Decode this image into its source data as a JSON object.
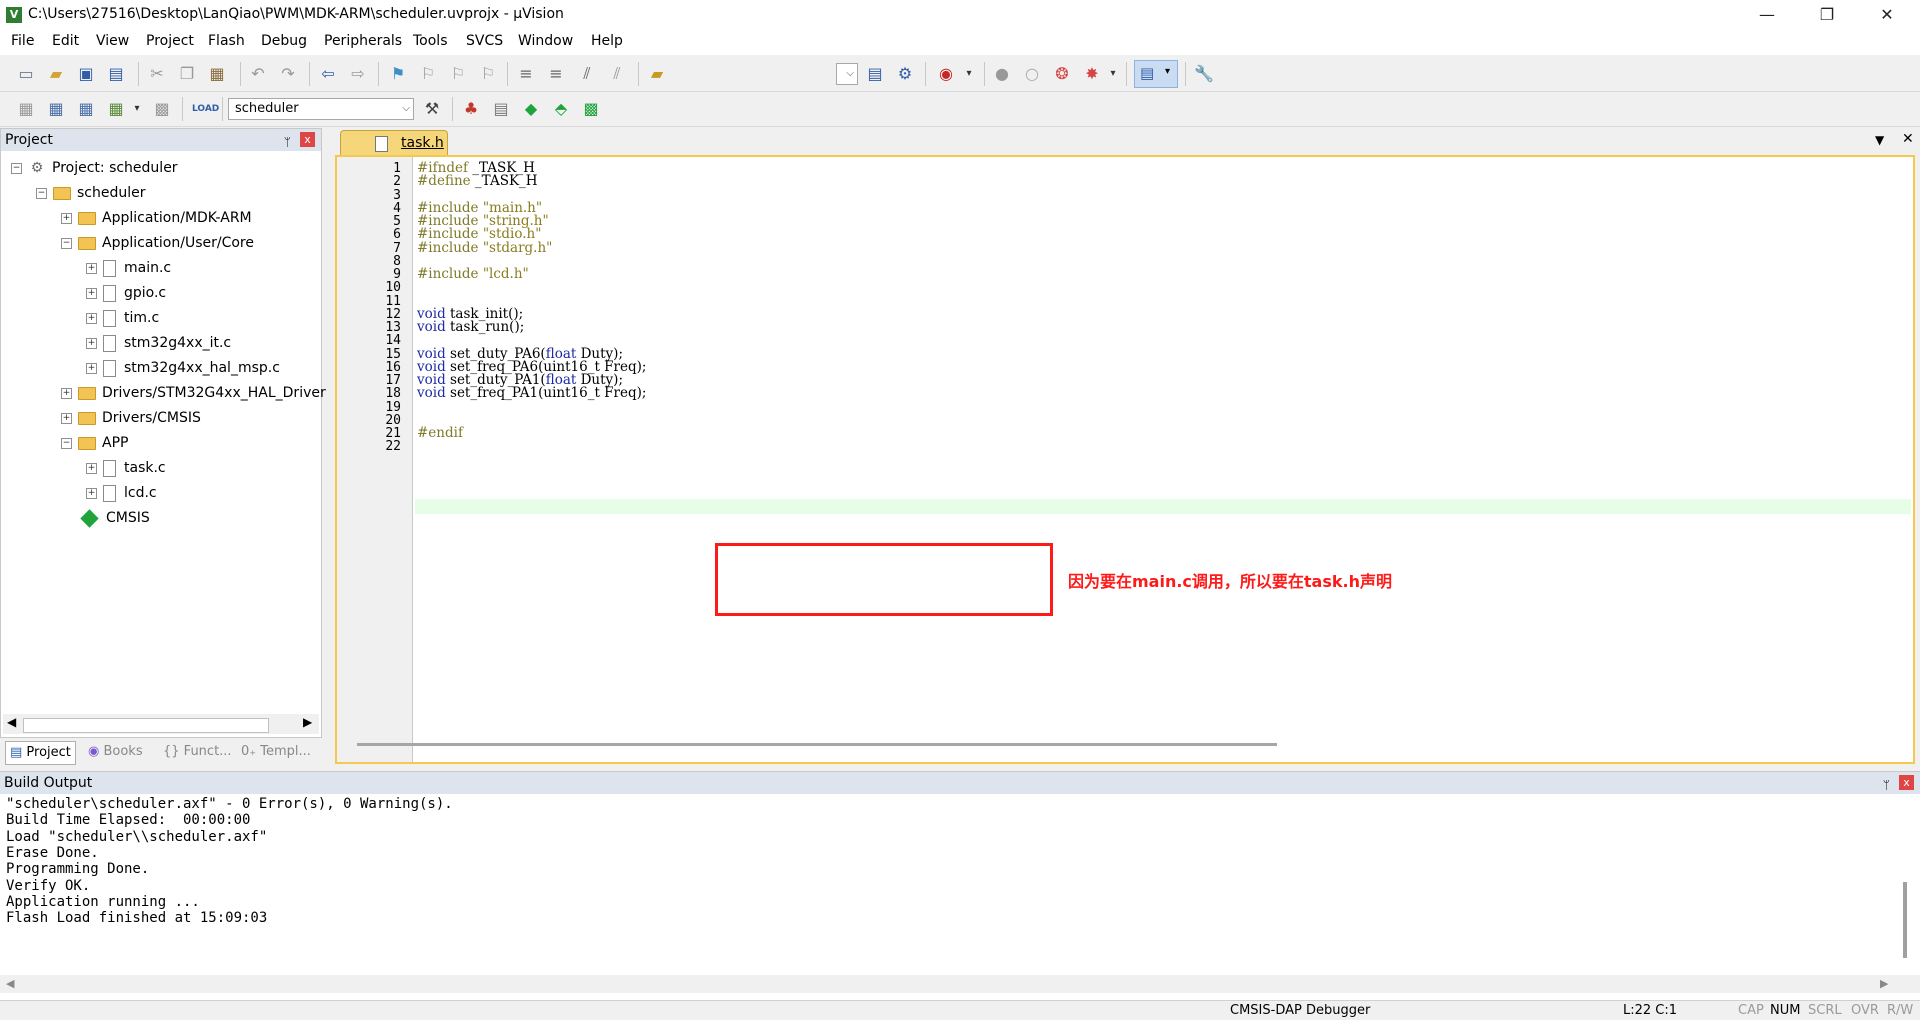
{
  "window": {
    "title": "C:\\Users\\27516\\Desktop\\LanQiao\\PWM\\MDK-ARM\\scheduler.uvprojx - µVision",
    "app_icon": "V",
    "minimize": "—",
    "maximize": "❐",
    "close": "✕"
  },
  "menu": [
    "File",
    "Edit",
    "View",
    "Project",
    "Flash",
    "Debug",
    "Peripherals",
    "Tools",
    "SVCS",
    "Window",
    "Help"
  ],
  "toolbar2": {
    "target": "scheduler"
  },
  "project_panel": {
    "title": "Project",
    "pin": "ᛘ",
    "close": "x",
    "tree": [
      {
        "label": "Project: scheduler"
      },
      {
        "label": "scheduler"
      },
      {
        "label": "Application/MDK-ARM"
      },
      {
        "label": "Application/User/Core"
      },
      {
        "label": "main.c"
      },
      {
        "label": "gpio.c"
      },
      {
        "label": "tim.c"
      },
      {
        "label": "stm32g4xx_it.c"
      },
      {
        "label": "stm32g4xx_hal_msp.c"
      },
      {
        "label": "Drivers/STM32G4xx_HAL_Driver"
      },
      {
        "label": "Drivers/CMSIS"
      },
      {
        "label": "APP"
      },
      {
        "label": "task.c"
      },
      {
        "label": "lcd.c"
      },
      {
        "label": "CMSIS"
      }
    ],
    "tabs": [
      "Project",
      "Books",
      "{} Funct...",
      "0₊ Templ..."
    ]
  },
  "editor": {
    "tab": "task.h",
    "lines": [
      {
        "n": "1",
        "pp": "#ifndef",
        "rest": " _TASK_H"
      },
      {
        "n": "2",
        "pp": "#define",
        "rest": " _TASK_H"
      },
      {
        "n": "3"
      },
      {
        "n": "4",
        "pp": "#include",
        "str": " \"main.h\""
      },
      {
        "n": "5",
        "pp": "#include",
        "str": " \"string.h\""
      },
      {
        "n": "6",
        "pp": "#include",
        "str": " \"stdio.h\""
      },
      {
        "n": "7",
        "pp": "#include",
        "str": " \"stdarg.h\""
      },
      {
        "n": "8"
      },
      {
        "n": "9",
        "pp": "#include",
        "str": " \"lcd.h\""
      },
      {
        "n": "10"
      },
      {
        "n": "11"
      },
      {
        "n": "12",
        "kw": "void",
        "rest": " task_init();"
      },
      {
        "n": "13",
        "kw": "void",
        "rest": " task_run();"
      },
      {
        "n": "14"
      },
      {
        "n": "15",
        "kw": "void",
        "rest": " set_duty_PA6(",
        "kw2": "float",
        "rest2": " Duty);"
      },
      {
        "n": "16",
        "kw": "void",
        "rest": " set_freq_PA6(uint16_t Freq);"
      },
      {
        "n": "17",
        "kw": "void",
        "rest": " set_duty_PA1(",
        "kw2": "float",
        "rest2": " Duty);"
      },
      {
        "n": "18",
        "kw": "void",
        "rest": " set_freq_PA1(uint16_t Freq);"
      },
      {
        "n": "19"
      },
      {
        "n": "20"
      },
      {
        "n": "21",
        "pp": "#endif"
      },
      {
        "n": "22"
      }
    ],
    "annotation": "因为要在main.c调用，所以要在task.h声明"
  },
  "build_output": {
    "title": "Build Output",
    "lines": [
      "\"scheduler\\scheduler.axf\" - 0 Error(s), 0 Warning(s).",
      "Build Time Elapsed:  00:00:00",
      "Load \"scheduler\\\\scheduler.axf\"",
      "Erase Done.",
      "Programming Done.",
      "Verify OK.",
      "Application running ...",
      "Flash Load finished at 15:09:03"
    ]
  },
  "status": {
    "debugger": "CMSIS-DAP Debugger",
    "position": "L:22 C:1",
    "cap": "CAP",
    "num": "NUM",
    "scrl": "SCRL",
    "ovr": "OVR",
    "rw": "R/W"
  },
  "colors": {
    "keyword": "#1d2aa8",
    "string": "#8a7c1e",
    "annotation": "#ff1a1a",
    "tab_active": "#f5d67a"
  }
}
